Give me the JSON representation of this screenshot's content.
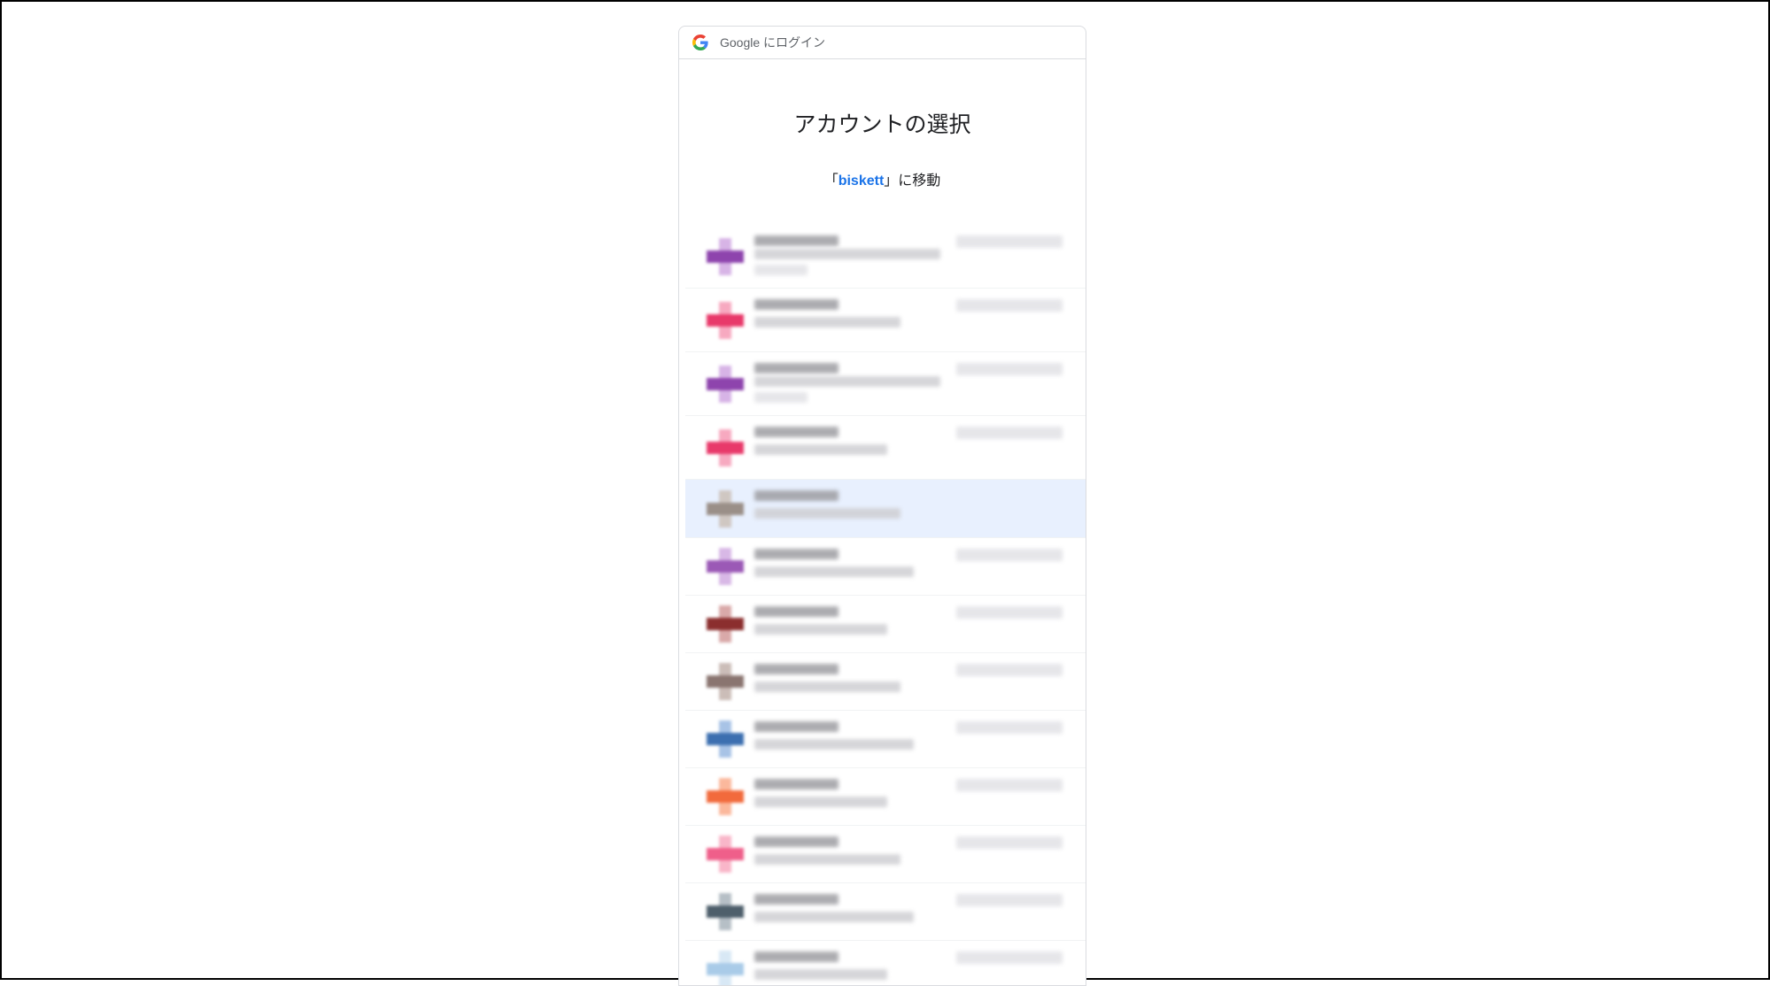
{
  "popup": {
    "header_text": "Google にログイン",
    "title": "アカウントの選択",
    "subtitle_prefix": "「",
    "subtitle_link": "biskett",
    "subtitle_suffix": "」に移動"
  },
  "accounts": [
    {
      "name": "",
      "email": "",
      "avatar_color": "#8e44ad",
      "avatar_light": "#d7b4e6",
      "selected": false
    },
    {
      "name": "",
      "email": "",
      "avatar_color": "#e8396a",
      "avatar_light": "#f7a9c0",
      "selected": false
    },
    {
      "name": "",
      "email": "",
      "avatar_color": "#8e44ad",
      "avatar_light": "#d7b4e6",
      "selected": false
    },
    {
      "name": "",
      "email": "",
      "avatar_color": "#e8396a",
      "avatar_light": "#f7a9c0",
      "selected": false
    },
    {
      "name": "",
      "email": "",
      "avatar_color": "#9a8f88",
      "avatar_light": "#cfc7c2",
      "selected": true
    },
    {
      "name": "",
      "email": "",
      "avatar_color": "#9b59b6",
      "avatar_light": "#d8b8e6",
      "selected": false
    },
    {
      "name": "",
      "email": "",
      "avatar_color": "#8b2e2e",
      "avatar_light": "#d9a9a9",
      "selected": false
    },
    {
      "name": "",
      "email": "",
      "avatar_color": "#8a7570",
      "avatar_light": "#cbbdb8",
      "selected": false
    },
    {
      "name": "",
      "email": "",
      "avatar_color": "#3c6fb0",
      "avatar_light": "#a8c3e6",
      "selected": false
    },
    {
      "name": "",
      "email": "",
      "avatar_color": "#f26a3c",
      "avatar_light": "#fbb89c",
      "selected": false
    },
    {
      "name": "",
      "email": "",
      "avatar_color": "#ef5f8a",
      "avatar_light": "#f9b6c9",
      "selected": false
    },
    {
      "name": "",
      "email": "",
      "avatar_color": "#4e5f6b",
      "avatar_light": "#b6bfc6",
      "selected": false
    },
    {
      "name": "",
      "email": "",
      "avatar_color": "#a9cbe8",
      "avatar_light": "#d8e8f5",
      "selected": false
    }
  ],
  "colors": {
    "link": "#1a73e8",
    "selected_row": "#e8f0fe",
    "border": "#dadce0"
  },
  "icons": {
    "google_logo": "google-g-icon"
  }
}
